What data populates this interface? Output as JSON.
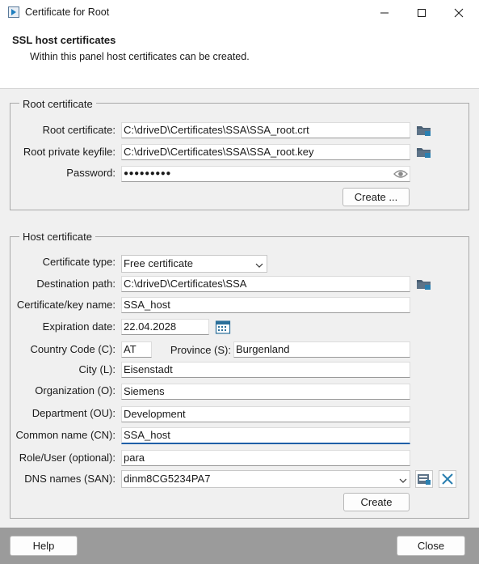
{
  "window": {
    "title": "Certificate for Root"
  },
  "header": {
    "title": "SSL host certificates",
    "subtitle": "Within this panel host certificates can be created."
  },
  "root": {
    "legend": "Root certificate",
    "cert_label": "Root certificate:",
    "cert_value": "C:\\driveD\\Certificates\\SSA\\SSA_root.crt",
    "key_label": "Root private keyfile:",
    "key_value": "C:\\driveD\\Certificates\\SSA\\SSA_root.key",
    "password_label": "Password:",
    "password_mask": "●●●●●●●●●",
    "create_label": "Create ..."
  },
  "host": {
    "legend": "Host certificate",
    "type_label": "Certificate type:",
    "type_value": "Free certificate",
    "dest_label": "Destination path:",
    "dest_value": "C:\\driveD\\Certificates\\SSA",
    "name_label": "Certificate/key name:",
    "name_value": "SSA_host",
    "exp_label": "Expiration date:",
    "exp_value": "22.04.2028",
    "country_label": "Country Code (C):",
    "country_value": "AT",
    "province_label": "Province (S):",
    "province_value": "Burgenland",
    "city_label": "City (L):",
    "city_value": "Eisenstadt",
    "org_label": "Organization (O):",
    "org_value": "Siemens",
    "dept_label": "Department (OU):",
    "dept_value": "Development",
    "cn_label": "Common name (CN):",
    "cn_value": "SSA_host",
    "role_label": "Role/User (optional):",
    "role_value": "para",
    "dns_label": "DNS names (SAN):",
    "dns_value": "dinm8CG5234PA7",
    "create_label": "Create"
  },
  "footer": {
    "help_label": "Help",
    "close_label": "Close"
  },
  "colors": {
    "accent": "#1f5fa8",
    "folder_icon": "#4a5f73",
    "clear_icon": "#2a7fb0"
  }
}
